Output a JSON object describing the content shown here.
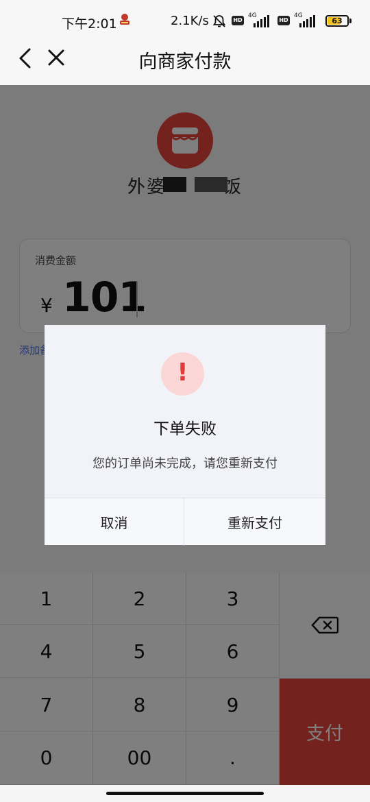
{
  "status_bar": {
    "time": "下午2:01",
    "network_speed": "2.1K/s",
    "hd_1": "HD",
    "hd_2": "HD",
    "net_1": "4G",
    "net_2": "4G",
    "battery_percent": "63",
    "battery_level": 0.63
  },
  "nav": {
    "title": "向商家付款"
  },
  "store": {
    "name": "外婆　　　饭"
  },
  "amount": {
    "label": "消费金额",
    "currency": "¥",
    "value": "101"
  },
  "add_note_label": "添加备注",
  "keypad": {
    "keys": [
      "1",
      "2",
      "3",
      "4",
      "5",
      "6",
      "7",
      "8",
      "9",
      "0",
      "00",
      "."
    ],
    "pay_label": "支付"
  },
  "dialog": {
    "icon": "!",
    "title": "下单失败",
    "message": "您的订单尚未完成，请您重新支付",
    "cancel_label": "取消",
    "retry_label": "重新支付"
  },
  "colors": {
    "accent_red": "#e8453c",
    "alert_red": "#e03a3a",
    "link_blue": "#4a6fd8"
  }
}
